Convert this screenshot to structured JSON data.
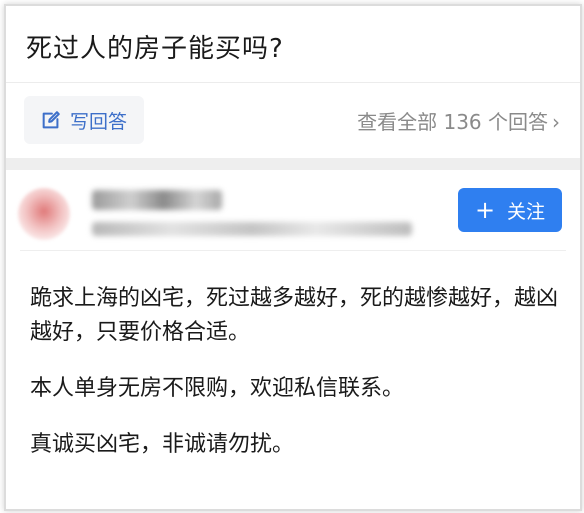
{
  "question": {
    "title": "死过人的房子能买吗?"
  },
  "actions": {
    "write_answer_label": "写回答",
    "view_all_label": "查看全部 136 个回答",
    "view_all_chevron": "›"
  },
  "author": {
    "follow_plus": "+",
    "follow_label": "关注"
  },
  "answer": {
    "paragraphs": [
      "跪求上海的凶宅，死过越多越好，死的越惨越好，越凶越好，只要价格合适。",
      "本人单身无房不限购，欢迎私信联系。",
      "真诚买凶宅，非诚请勿扰。"
    ]
  },
  "colors": {
    "accent": "#2f7ff0",
    "link": "#3d6fc9",
    "muted": "#8a8a8a"
  }
}
